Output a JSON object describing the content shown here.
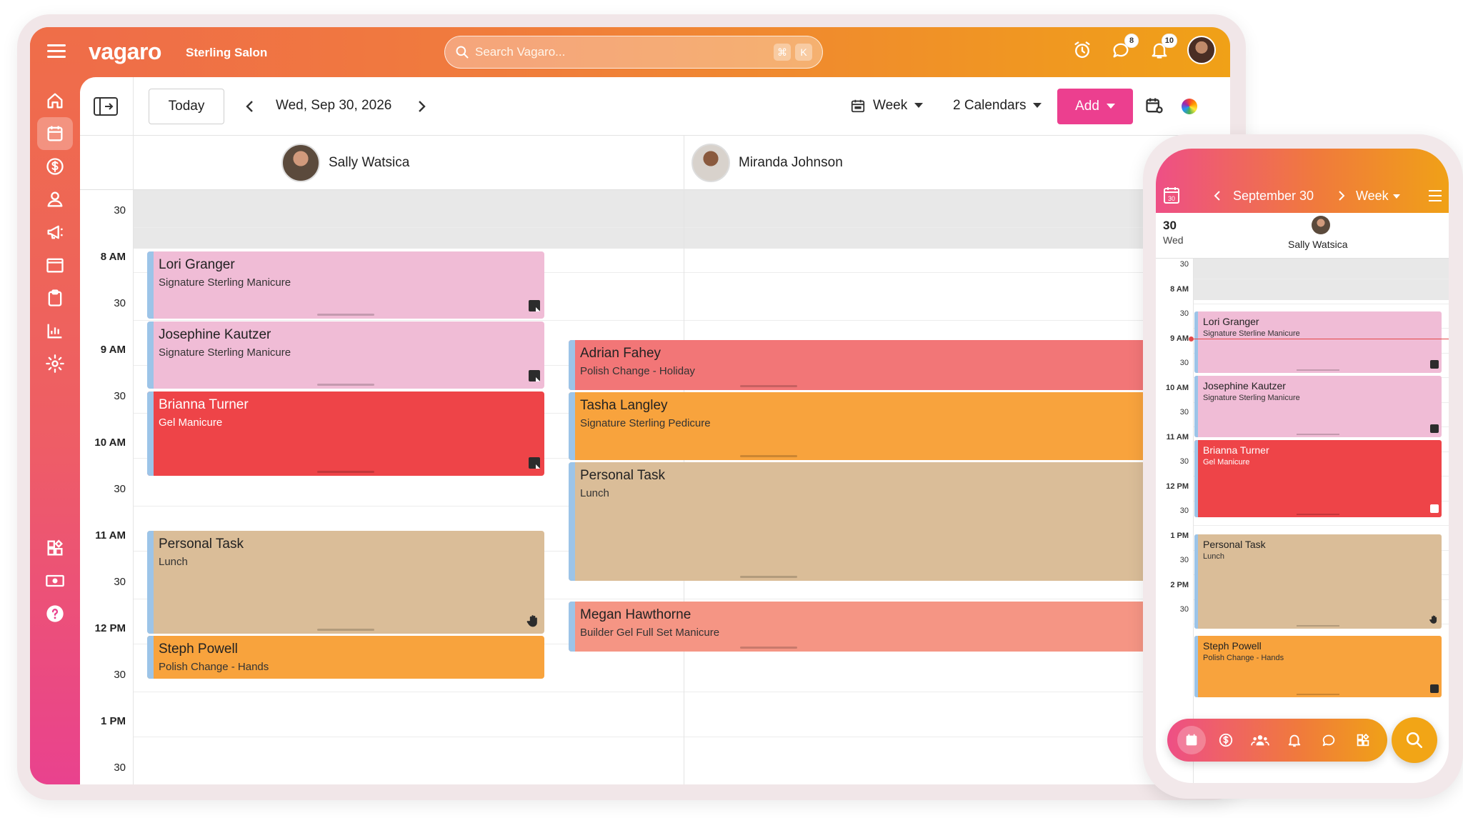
{
  "topbar": {
    "logo": "vagaro",
    "salon": "Sterling Salon",
    "search_placeholder": "Search Vagaro...",
    "kbd_cmd": "⌘",
    "kbd_k": "K",
    "messages_badge": "8",
    "notifications_badge": "10"
  },
  "sidenav": [
    "home-icon",
    "calendar-icon",
    "dollar-icon",
    "user-icon",
    "megaphone-icon",
    "window-icon",
    "clipboard-icon",
    "chart-icon",
    "gear-icon",
    "apps-icon",
    "cash-icon",
    "help-icon"
  ],
  "toolbar": {
    "today": "Today",
    "date": "Wed, Sep 30, 2026",
    "view": "Week",
    "calendars": "2 Calendars",
    "add": "Add"
  },
  "staff": [
    {
      "name": "Sally Watsica"
    },
    {
      "name": "Miranda Johnson"
    }
  ],
  "time_labels": [
    {
      "label": "30",
      "hour": false
    },
    {
      "label": "8 AM",
      "hour": true
    },
    {
      "label": "30",
      "hour": false
    },
    {
      "label": "9 AM",
      "hour": true
    },
    {
      "label": "30",
      "hour": false
    },
    {
      "label": "10 AM",
      "hour": true
    },
    {
      "label": "30",
      "hour": false
    },
    {
      "label": "11 AM",
      "hour": true
    },
    {
      "label": "30",
      "hour": false
    },
    {
      "label": "12 PM",
      "hour": true
    },
    {
      "label": "30",
      "hour": false
    },
    {
      "label": "1 PM",
      "hour": true
    },
    {
      "label": "30",
      "hour": false
    }
  ],
  "appointments": {
    "sally": [
      {
        "name": "Lori Granger",
        "service": "Signature Sterling Manicure",
        "color": "#f0bcd6"
      },
      {
        "name": "Josephine Kautzer",
        "service": "Signature Sterling Manicure",
        "color": "#f0bcd6"
      },
      {
        "name": "Brianna Turner",
        "service": "Gel Manicure",
        "color": "#ee4448"
      },
      {
        "name": "Personal Task",
        "service": "Lunch",
        "color": "#dabd98"
      },
      {
        "name": "Steph Powell",
        "service": "Polish Change - Hands",
        "color": "#f8a33d"
      }
    ],
    "miranda": [
      {
        "name": "Adrian Fahey",
        "service": "Polish Change - Holiday",
        "color": "#f27677"
      },
      {
        "name": "Tasha Langley",
        "service": "Signature Sterling Pedicure",
        "color": "#f8a33d"
      },
      {
        "name": "Personal Task",
        "service": "Lunch",
        "color": "#dabd98"
      },
      {
        "name": "Megan Hawthorne",
        "service": "Builder Gel Full Set Manicure",
        "color": "#f59584"
      }
    ]
  },
  "phone": {
    "month": "September 30",
    "view": "Week",
    "cal_day": "30",
    "day_num": "30",
    "day_name": "Wed",
    "staff_name": "Sally Watsica",
    "time_labels": [
      {
        "label": "30",
        "hour": false
      },
      {
        "label": "8 AM",
        "hour": true
      },
      {
        "label": "30",
        "hour": false
      },
      {
        "label": "9 AM",
        "hour": true
      },
      {
        "label": "30",
        "hour": false
      },
      {
        "label": "10 AM",
        "hour": true
      },
      {
        "label": "30",
        "hour": false
      },
      {
        "label": "11 AM",
        "hour": true
      },
      {
        "label": "30",
        "hour": false
      },
      {
        "label": "12 PM",
        "hour": true
      },
      {
        "label": "30",
        "hour": false
      },
      {
        "label": "1 PM",
        "hour": true
      },
      {
        "label": "30",
        "hour": false
      },
      {
        "label": "2 PM",
        "hour": true
      },
      {
        "label": "30",
        "hour": false
      }
    ],
    "appointments": [
      {
        "name": "Lori Granger",
        "service": "Signature Sterline Manicure",
        "color": "#f0bcd6"
      },
      {
        "name": "Josephine Kautzer",
        "service": "Signature Sterling Manicure",
        "color": "#f0bcd6"
      },
      {
        "name": "Brianna Turner",
        "service": "Gel Manicure",
        "color": "#ee4448"
      },
      {
        "name": "Personal Task",
        "service": "Lunch",
        "color": "#dabd98"
      },
      {
        "name": "Steph Powell",
        "service": "Polish Change - Hands",
        "color": "#f8a33d"
      }
    ],
    "dock": [
      "calendar-icon",
      "dollar-icon",
      "people-icon",
      "bell-icon",
      "chat-icon",
      "apps-icon"
    ]
  }
}
